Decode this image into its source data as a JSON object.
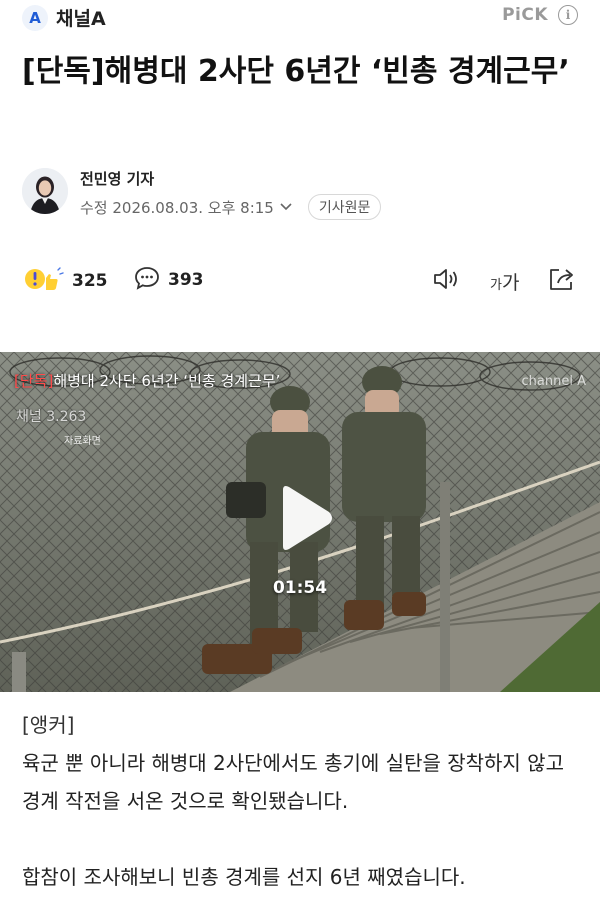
{
  "brand": {
    "logo_letter": "A",
    "name": "채널A"
  },
  "pick": {
    "label": "PiCK",
    "info_icon": "info-icon"
  },
  "article": {
    "headline": "[단독]해병대 2사단 6년간 ‘빈총 경계근무’",
    "reporter": "전민영 기자",
    "dateline": "수정 2026.08.03. 오후 8:15",
    "source_button": "기사원문"
  },
  "actions": {
    "reaction_count": "325",
    "comment_count": "393",
    "font_small": "가",
    "font_large": "가",
    "icons": [
      "reaction-emoji-icon",
      "comment-icon",
      "speaker-icon",
      "font-size-icon",
      "share-icon"
    ]
  },
  "video": {
    "title_tag": "[단독]",
    "title": "해병대 2사단 6년간 ‘빈총 경계근무’",
    "caption": "채널 3.263",
    "sub_caption": "자료화면",
    "watermark": "channel A",
    "duration": "01:54",
    "play_icon": "play-icon"
  },
  "body": {
    "anchor_label": "[앵커]",
    "paragraph1": "육군 뿐 아니라 해병대 2사단에서도 총기에 실탄을 장착하지 않고 경계 작전을 서온 것으로 확인됐습니다.",
    "paragraph2": "합참이 조사해보니 빈총 경계를 선지 6년 째였습니다."
  },
  "colors": {
    "brand_blue": "#1f5cd6",
    "pick_gray": "#9a9a9a",
    "title_tag_red": "#ff4b4b"
  }
}
